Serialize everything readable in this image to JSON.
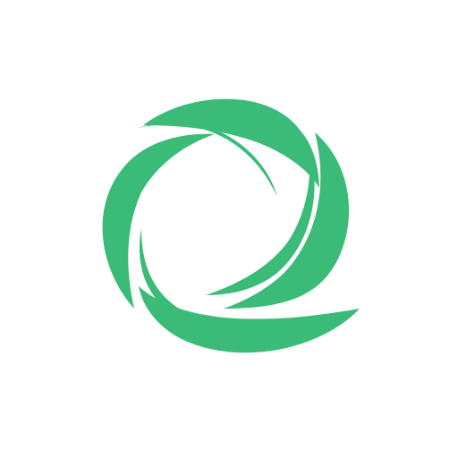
{
  "logo": {
    "icon": "swirl-logo-icon",
    "color": "#3bbb78",
    "background": "#ffffff"
  }
}
